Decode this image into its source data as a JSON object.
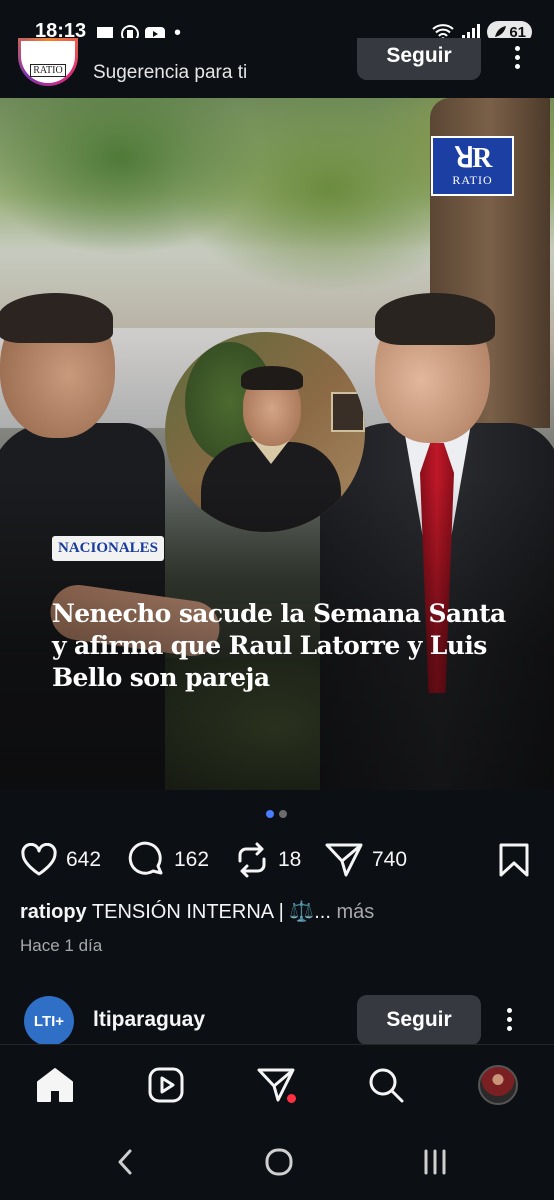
{
  "status_bar": {
    "time": "18:13",
    "battery": "61",
    "dot": "•"
  },
  "post": {
    "subtitle": "Sugerencia para ti",
    "follow_label": "Seguir",
    "avatar_text": "RATIO",
    "image": {
      "logo_mark": "ꓤR",
      "logo_text": "RATIO",
      "category": "NACIONALES",
      "headline": "Nenecho sacude la Semana Santa y afirma que Raul Latorre y Luis Bello son pareja"
    },
    "carousel": {
      "current": 1,
      "total": 2
    },
    "likes": "642",
    "comments": "162",
    "reposts": "18",
    "shares": "740",
    "caption_user": "ratiopy",
    "caption_text": "TENSIÓN INTERNA | ⚖️...",
    "caption_more": " más",
    "time_ago": "Hace 1 día"
  },
  "next_post": {
    "avatar_text": "LTI+",
    "username": "ltiparaguay",
    "follow_label": "Seguir"
  },
  "nav": {
    "items": [
      "home-icon",
      "reels-icon",
      "messages-icon",
      "search-icon",
      "profile-avatar"
    ]
  },
  "system_nav": [
    "back-icon",
    "home-circle-icon",
    "recents-icon"
  ],
  "colors": {
    "background": "#0c1014",
    "follow_button": "#363a40",
    "accent_blue": "#1b3fa3",
    "dot_active": "#4a7dff",
    "dot_inactive": "#6b6b6b",
    "notification": "#ff3040"
  }
}
